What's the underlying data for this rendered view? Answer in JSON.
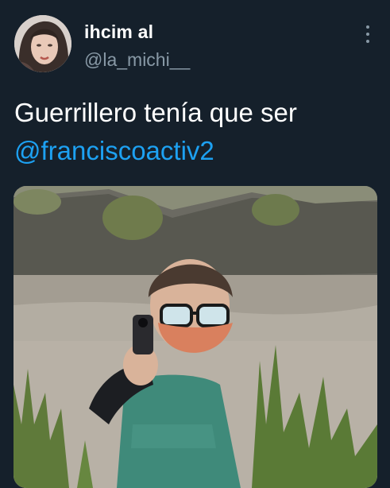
{
  "tweet": {
    "author": {
      "display_name": "ihcim al",
      "handle": "@la_michi__"
    },
    "text_line1": "Guerrillero tenía que ser",
    "mention": "@franciscoactiv2",
    "more_icon": "more-vertical-icon",
    "media_alt": "Photo"
  },
  "colors": {
    "background": "#15202b",
    "text": "#ffffff",
    "secondary": "#8899a6",
    "link": "#1da1f2"
  }
}
